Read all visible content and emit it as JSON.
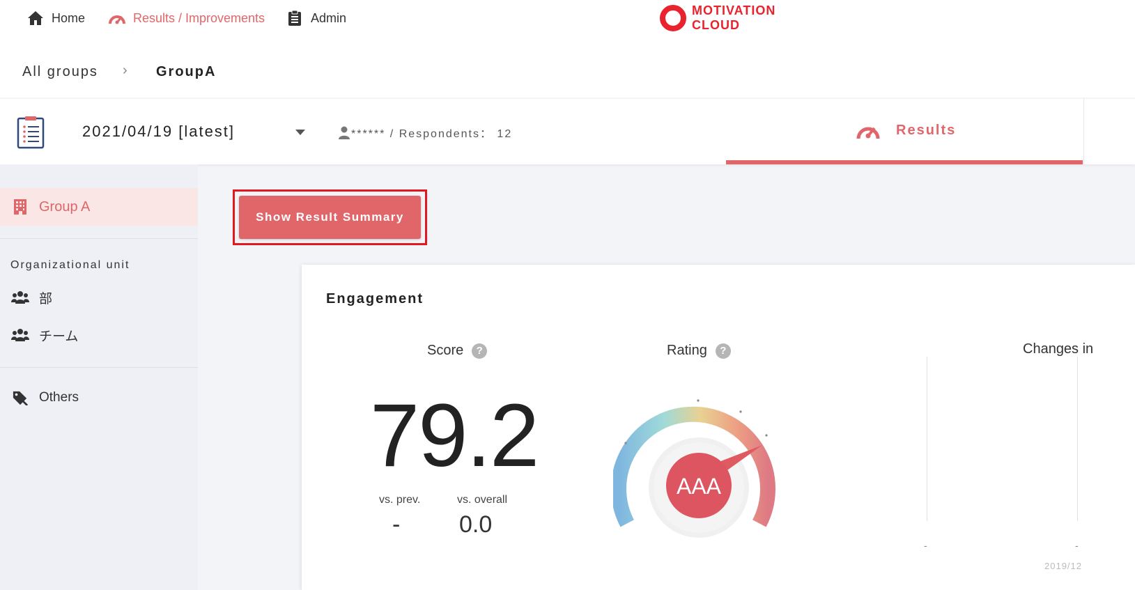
{
  "nav": {
    "home": "Home",
    "results": "Results / Improvements",
    "admin": "Admin",
    "logo_line1": "MOTIVATION",
    "logo_line2": "CLOUD"
  },
  "breadcrumb": {
    "all": "All groups",
    "separator": "›",
    "current": "GroupA"
  },
  "survey": {
    "date": "2021/04/19 [latest]",
    "respondents": "****** / Respondents： 12",
    "tab_results": "Results"
  },
  "sidebar": {
    "group": "Group A",
    "heading": "Organizational unit",
    "items": [
      "部",
      "チーム"
    ],
    "others": "Others"
  },
  "main": {
    "summary_button": "Show Result Summary"
  },
  "engagement": {
    "title": "Engagement",
    "score_label": "Score",
    "score": "79.2",
    "vs_prev_label": "vs. prev.",
    "vs_prev": "-",
    "vs_overall_label": "vs. overall",
    "vs_overall": "0.0",
    "rating_label": "Rating",
    "rating": "AAA",
    "help": "?",
    "changes_label": "Changes in",
    "dash": "-",
    "date_fragment": "2019/12"
  },
  "colors": {
    "accent": "#e0666a",
    "logo_red": "#e8232d",
    "highlight_border": "#e4161f",
    "sidebar_active_bg": "#fbe6e6"
  },
  "icons": [
    "home-icon",
    "gauge-icon",
    "clipboard-icon",
    "logo-icon",
    "survey-icon",
    "person-icon",
    "building-icon",
    "people-icon",
    "tag-icon",
    "help-icon"
  ]
}
